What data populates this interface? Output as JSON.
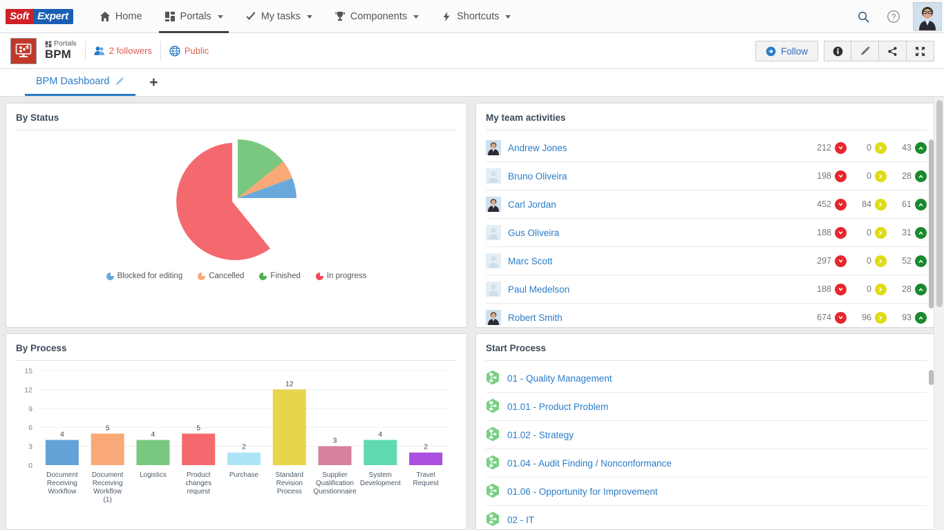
{
  "topnav": {
    "logo_part1": "Soft",
    "logo_part2": "Expert",
    "items": [
      {
        "label": "Home",
        "icon": "home-icon",
        "caret": false,
        "active": false
      },
      {
        "label": "Portals",
        "icon": "grid-icon",
        "caret": true,
        "active": true
      },
      {
        "label": "My tasks",
        "icon": "check-icon",
        "caret": true,
        "active": false
      },
      {
        "label": "Components",
        "icon": "trophy-icon",
        "caret": true,
        "active": false
      },
      {
        "label": "Shortcuts",
        "icon": "bolt-icon",
        "caret": true,
        "active": false
      }
    ],
    "search_icon": "search-icon",
    "help_icon": "help-icon",
    "avatar": "user-avatar"
  },
  "subheader": {
    "tile_icon": "bpm-process-icon",
    "category": "Portals",
    "title": "BPM",
    "followers": "2 followers",
    "followers_icon": "followers-icon",
    "visibility": "Public",
    "visibility_icon": "globe-icon",
    "follow_label": "Follow",
    "follow_icon": "arrow-circle-right-icon",
    "actions": [
      {
        "name": "info-button",
        "icon": "info-icon"
      },
      {
        "name": "edit-button",
        "icon": "pencil-icon"
      },
      {
        "name": "share-button",
        "icon": "share-icon"
      },
      {
        "name": "fullscreen-button",
        "icon": "expand-icon"
      }
    ]
  },
  "tabs": {
    "items": [
      {
        "label": "BPM Dashboard",
        "edit_icon": "pencil-icon",
        "active": true
      }
    ],
    "add_label": "+"
  },
  "panels": {
    "by_status": "By Status",
    "my_team_activities": "My team activities",
    "by_process": "By Process",
    "start_process": "Start Process"
  },
  "chart_data": [
    {
      "type": "pie",
      "title": "By Status",
      "categories": [
        "Blocked for editing",
        "Cancelled",
        "Finished",
        "In progress"
      ],
      "values": [
        3,
        2,
        7,
        50
      ],
      "colors": [
        "#6aa8dc",
        "#f9a977",
        "#7ac87f",
        "#f4696e"
      ],
      "exploded": [
        "Blocked for editing",
        "Cancelled",
        "Finished"
      ],
      "legend_position": "bottom",
      "legend_icon": "pie-slice-icon"
    },
    {
      "type": "bar",
      "title": "By Process",
      "categories": [
        "Document Receiving Workflow",
        "Document Receiving Workflow(1)",
        "Logistics",
        "Product changes request",
        "Purchase",
        "Standard Revision Process",
        "Supplier Qualification Questionnaire",
        "System Development",
        "Travel Request"
      ],
      "values": [
        4,
        5,
        4,
        5,
        2,
        12,
        3,
        4,
        2
      ],
      "colors": [
        "#63a3d8",
        "#f9a977",
        "#7ac87f",
        "#f4696e",
        "#aee4f7",
        "#e9d košt",
        "#d67f9e",
        "#5fd9b0",
        "#aa4fe0"
      ],
      "bar_colors": [
        "#63a3d8",
        "#f9a977",
        "#7ac87f",
        "#f4696e",
        "#aee4f7",
        "#e8d44d",
        "#d67f9e",
        "#5fd9b0",
        "#aa4fe0"
      ],
      "ytick_labels": [
        "0",
        "3",
        "6",
        "9",
        "12",
        "15"
      ],
      "ylim": [
        0,
        15
      ],
      "grid": true,
      "xlabel": "",
      "ylabel": ""
    }
  ],
  "team_activities": {
    "columns": [
      "overdue",
      "pending",
      "ontime"
    ],
    "rows": [
      {
        "name": "Andrew Jones",
        "avatar": "photo",
        "overdue": "212",
        "pending": "0",
        "ontime": "43"
      },
      {
        "name": "Bruno Oliveira",
        "avatar": "blank",
        "overdue": "198",
        "pending": "0",
        "ontime": "28"
      },
      {
        "name": "Carl Jordan",
        "avatar": "photo",
        "overdue": "452",
        "pending": "84",
        "ontime": "61"
      },
      {
        "name": "Gus Oliveira",
        "avatar": "blank",
        "overdue": "188",
        "pending": "0",
        "ontime": "31"
      },
      {
        "name": "Marc Scott",
        "avatar": "blank",
        "overdue": "297",
        "pending": "0",
        "ontime": "52"
      },
      {
        "name": "Paul Medelson",
        "avatar": "blank",
        "overdue": "188",
        "pending": "0",
        "ontime": "28"
      },
      {
        "name": "Robert Smith",
        "avatar": "photo",
        "overdue": "674",
        "pending": "96",
        "ontime": "93"
      }
    ],
    "badge_colors": {
      "overdue": "#e8262d",
      "pending": "#dfdb15",
      "ontime": "#1a8a2e"
    },
    "badge_icons": {
      "overdue": "chevron-down-icon",
      "pending": "chevron-right-icon",
      "ontime": "chevron-up-icon"
    }
  },
  "start_process": {
    "icon": "process-hex-icon",
    "items": [
      "01 - Quality Management",
      "01.01 - Product Problem",
      "01.02 - Strategy",
      "01.04 - Audit Finding / Nonconformance",
      "01.06 - Opportunity for Improvement",
      "02 - IT"
    ]
  },
  "colors": {
    "link": "#2a7cc7",
    "accent_red": "#e05a4f",
    "brand_red": "#cf2027",
    "brand_blue": "#1a5fb4"
  }
}
